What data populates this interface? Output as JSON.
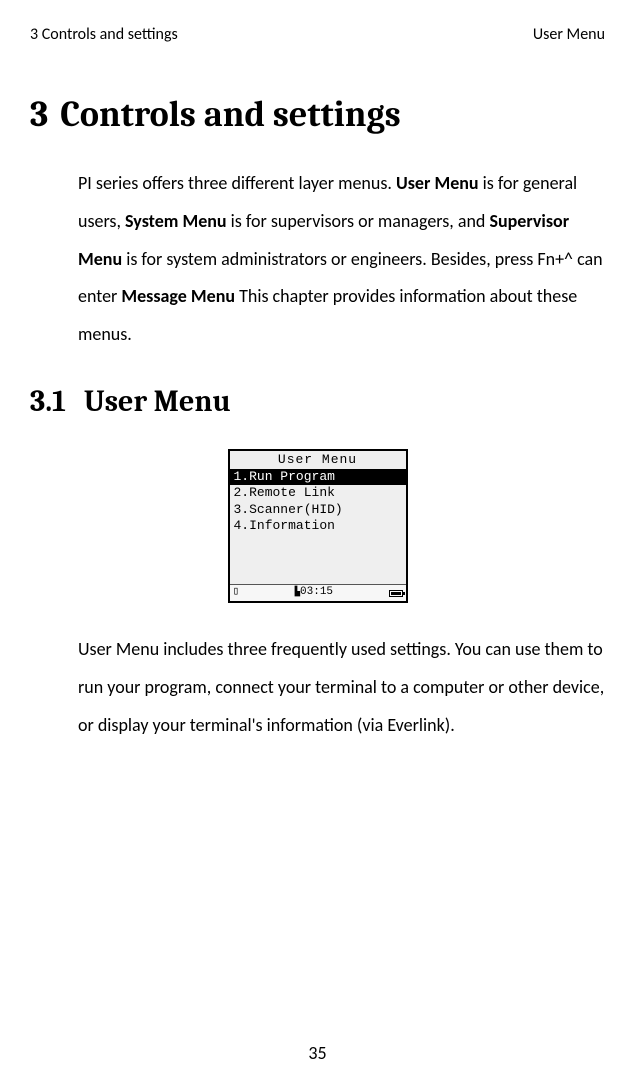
{
  "header": {
    "left": "3 Controls and settings",
    "right": "User Menu"
  },
  "chapter": {
    "num": "3",
    "title": "Controls and settings"
  },
  "intro": {
    "seg1": "PI series offers three different layer menus. ",
    "bold1": "User Menu",
    "seg2": " is for general users, ",
    "bold2": "System Menu",
    "seg3": " is for supervisors or managers, and ",
    "bold3": "Supervisor Menu",
    "seg4": " is for system administrators or engineers. Besides, press Fn+^ can enter ",
    "bold4": "Message Menu",
    "seg5": " This chapter provides information about these menus."
  },
  "section": {
    "num": "3.1",
    "title": "User Menu"
  },
  "lcd": {
    "title": "User Menu",
    "items": [
      "1.Run Program",
      "2.Remote Link",
      "3.Scanner(HID)",
      "4.Information"
    ],
    "selected_index": 0,
    "clock": "03:15",
    "signal": "▯"
  },
  "body2": "User Menu includes three frequently used settings. You can use them to run your program, connect your terminal to a computer or other device, or display your terminal's information (via Everlink).",
  "page_number": "35"
}
